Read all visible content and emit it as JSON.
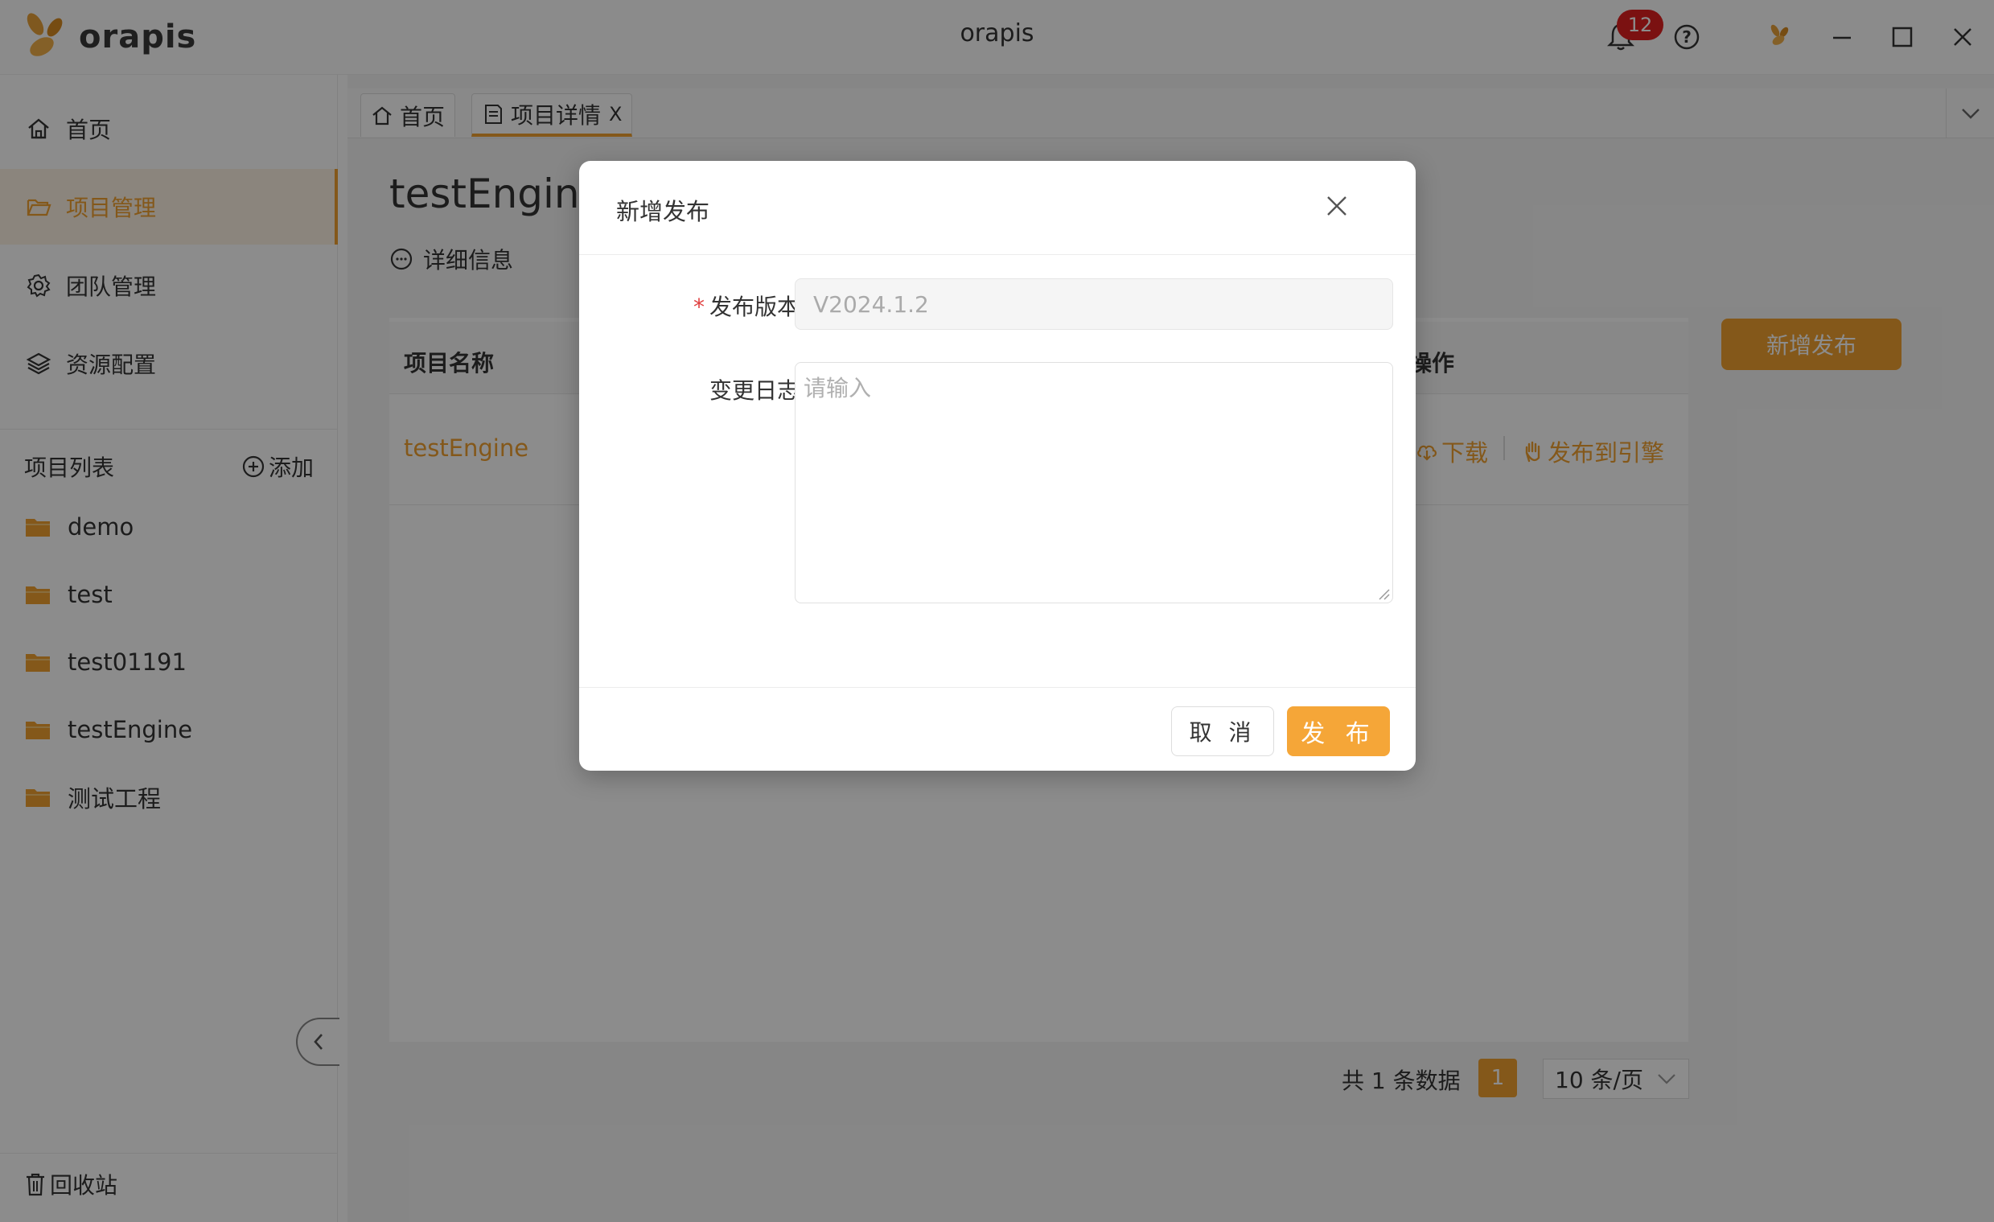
{
  "window": {
    "title": "orapis",
    "logo_text": "orapis",
    "notification_count": "12",
    "accent_color": "#f0a030"
  },
  "sidebar": {
    "nav": [
      {
        "label": "首页",
        "icon": "home-icon"
      },
      {
        "label": "项目管理",
        "icon": "folder-open-icon",
        "active": true
      },
      {
        "label": "团队管理",
        "icon": "gear-icon"
      },
      {
        "label": "资源配置",
        "icon": "layers-icon"
      }
    ],
    "project_list_title": "项目列表",
    "add_label": "添加",
    "projects": [
      "demo",
      "test",
      "test01191",
      "testEngine",
      "测试工程"
    ],
    "recycle_label": "回收站"
  },
  "tabs": [
    {
      "label": "首页",
      "icon": "home-icon"
    },
    {
      "label": "项目详情",
      "icon": "document-icon",
      "closable": "X",
      "active": true
    }
  ],
  "main": {
    "title": "testEngine",
    "detail_link": "详细信息",
    "new_release_button": "新增发布",
    "table": {
      "col_name": "项目名称",
      "col_ops": "操作",
      "row_name": "testEngine",
      "op_download": "下载",
      "op_publish": "发布到引擎"
    },
    "pager": {
      "total": "共 1 条数据",
      "current": "1",
      "size": "10 条/页"
    }
  },
  "modal": {
    "title": "新增发布",
    "version_label": "发布版本",
    "version_value": "V2024.1.2",
    "log_label": "变更日志",
    "log_placeholder": "请输入",
    "cancel": "取 消",
    "ok": "发 布"
  }
}
